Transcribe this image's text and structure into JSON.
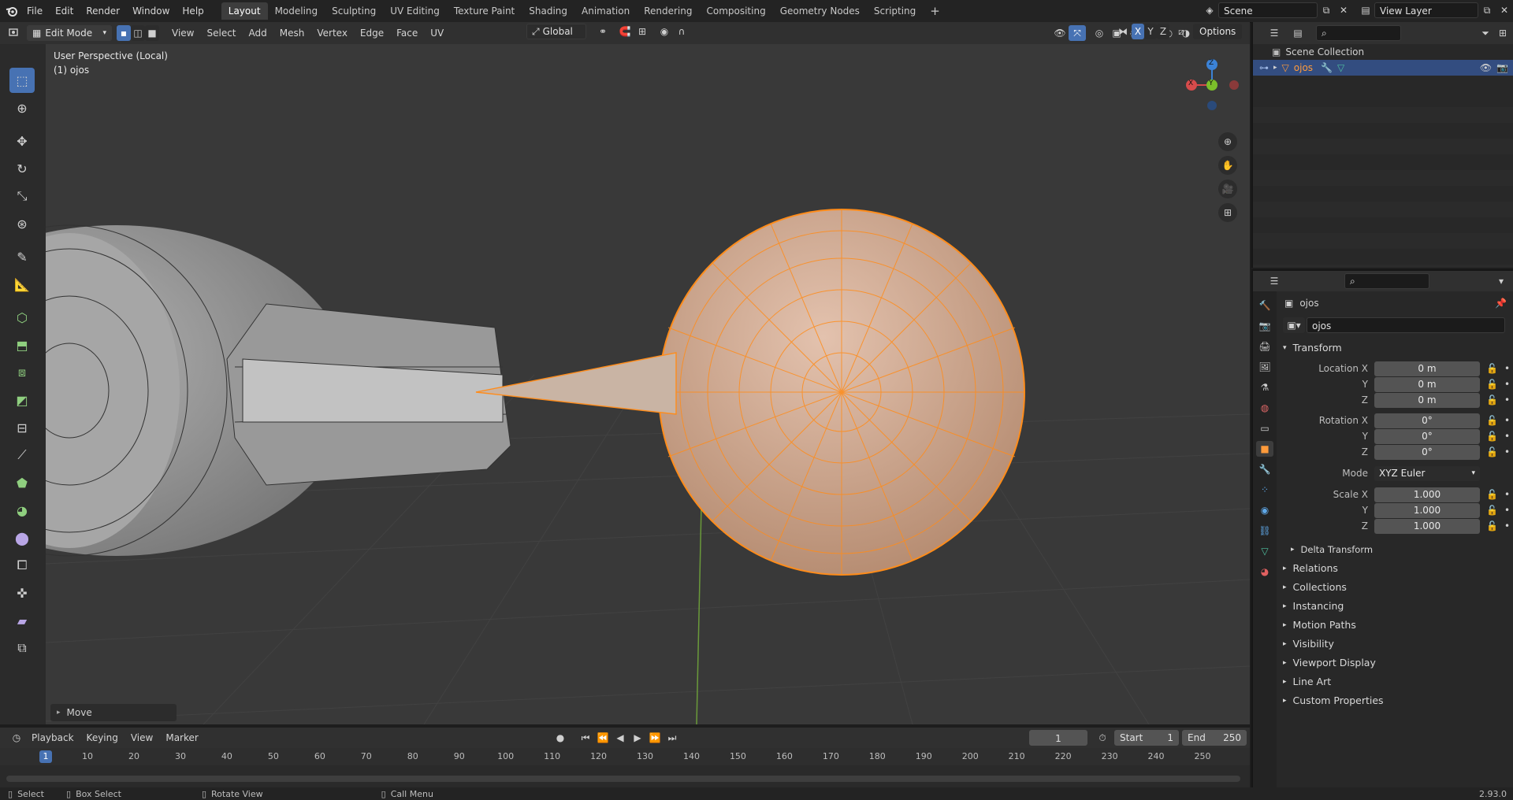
{
  "app": {
    "version": "2.93.0"
  },
  "topbar": {
    "menus": [
      "File",
      "Edit",
      "Render",
      "Window",
      "Help"
    ],
    "workspaces": [
      "Layout",
      "Modeling",
      "Sculpting",
      "UV Editing",
      "Texture Paint",
      "Shading",
      "Animation",
      "Rendering",
      "Compositing",
      "Geometry Nodes",
      "Scripting"
    ],
    "active_workspace": "Layout",
    "scene": "Scene",
    "view_layer": "View Layer"
  },
  "viewport_header": {
    "mode": "Edit Mode",
    "menus": [
      "View",
      "Select",
      "Add",
      "Mesh",
      "Vertex",
      "Edge",
      "Face",
      "UV"
    ],
    "transform_orientation": "Global",
    "options_label": "Options",
    "axis_labels": [
      "X",
      "Y",
      "Z"
    ]
  },
  "viewport": {
    "perspective_label": "User Perspective (Local)",
    "object_label": "(1) ojos",
    "gizmo_axes": {
      "x": "X",
      "y": "Y",
      "z": "Z"
    },
    "last_operator": "Move",
    "colors": {
      "background": "#393939",
      "selection": "#ff8c1a",
      "grid_y_axis": "#6a9a3a"
    }
  },
  "outliner": {
    "root": "Scene Collection",
    "items": [
      {
        "name": "ojos",
        "selected": true
      }
    ]
  },
  "properties": {
    "object_name": "ojos",
    "data_name": "ojos",
    "transform": {
      "title": "Transform",
      "location_label": "Location X",
      "location": [
        "0 m",
        "0 m",
        "0 m"
      ],
      "rotation_label": "Rotation X",
      "rotation": [
        "0°",
        "0°",
        "0°"
      ],
      "mode_label": "Mode",
      "mode": "XYZ Euler",
      "scale_label": "Scale X",
      "scale": [
        "1.000",
        "1.000",
        "1.000"
      ],
      "y_label": "Y",
      "z_label": "Z"
    },
    "delta_transform": "Delta Transform",
    "panels": [
      "Relations",
      "Collections",
      "Instancing",
      "Motion Paths",
      "Visibility",
      "Viewport Display",
      "Line Art",
      "Custom Properties"
    ]
  },
  "timeline": {
    "menus": [
      "Playback",
      "Keying",
      "View",
      "Marker"
    ],
    "current_frame": "1",
    "start_label": "Start",
    "start": "1",
    "end_label": "End",
    "end": "250",
    "ruler": [
      "1",
      "10",
      "20",
      "30",
      "40",
      "50",
      "60",
      "70",
      "80",
      "90",
      "100",
      "110",
      "120",
      "130",
      "140",
      "150",
      "160",
      "170",
      "180",
      "190",
      "200",
      "210",
      "220",
      "230",
      "240",
      "250"
    ]
  },
  "statusbar": {
    "items": [
      "Select",
      "Box Select",
      "Rotate View",
      "Call Menu"
    ]
  }
}
